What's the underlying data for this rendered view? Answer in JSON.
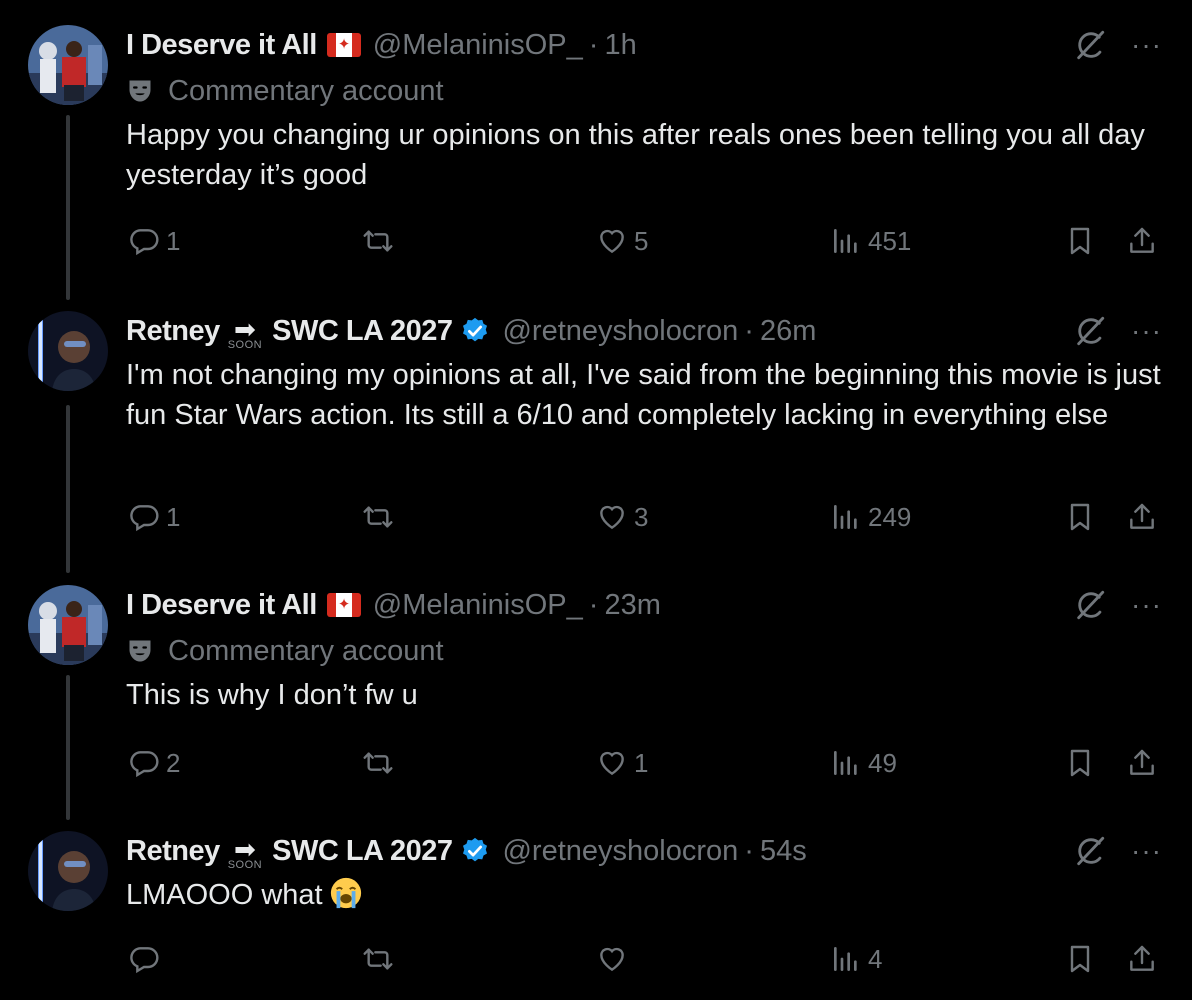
{
  "tweets": [
    {
      "name": "I Deserve it All",
      "flag": "🇨🇦",
      "handle": "@MelaninisOP_",
      "time": "1h",
      "label": "Commentary account",
      "text": "Happy you changing ur opinions on this after reals ones been telling you all day yesterday it’s good",
      "replies": "1",
      "retweets": "",
      "likes": "5",
      "views": "451"
    },
    {
      "name": "Retney",
      "soon": "SOON",
      "name2": "SWC LA 2027",
      "handle": "@retneysholocron",
      "time": "26m",
      "text": "I'm not changing my opinions at all, I've said from the beginning this movie is just fun Star Wars action. Its still a 6/10 and completely lacking in everything else",
      "replies": "1",
      "retweets": "",
      "likes": "3",
      "views": "249"
    },
    {
      "name": "I Deserve it All",
      "flag": "🇨🇦",
      "handle": "@MelaninisOP_",
      "time": "23m",
      "label": "Commentary account",
      "text": "This is why I don’t fw u",
      "replies": "2",
      "retweets": "",
      "likes": "1",
      "views": "49"
    },
    {
      "name": "Retney",
      "soon": "SOON",
      "name2": "SWC LA 2027",
      "handle": "@retneysholocron",
      "time": "54s",
      "text": "LMAOOO what",
      "emoji": "loudly-crying-face",
      "replies": "",
      "retweets": "",
      "likes": "",
      "views": "4"
    }
  ],
  "icons": {
    "label": "commentary-mask-icon",
    "grok": "grok-icon",
    "more": "more-icon",
    "reply": "reply-icon",
    "retweet": "retweet-icon",
    "like": "like-icon",
    "views": "views-icon",
    "bookmark": "bookmark-icon",
    "share": "share-icon"
  },
  "colors": {
    "background": "#000000",
    "text": "#e7e9ea",
    "muted": "#71767b",
    "verified": "#1d9bf0",
    "thread_line": "#333639"
  }
}
